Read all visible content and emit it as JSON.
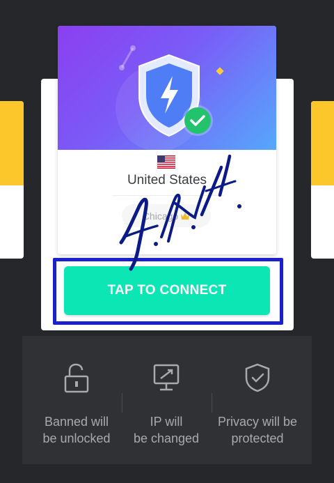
{
  "server": {
    "country": "United States",
    "city": "Chicago",
    "flag_icon": "us-flag-icon",
    "vip_icon": "crown-icon"
  },
  "connect": {
    "label": "TAP TO CONNECT"
  },
  "features": [
    {
      "icon": "unlock-icon",
      "line1": "Banned will",
      "line2": "be unlocked"
    },
    {
      "icon": "monitor-ip-icon",
      "line1": "IP will",
      "line2": "be changed"
    },
    {
      "icon": "shield-check-icon",
      "line1": "Privacy will be",
      "line2": "protected"
    }
  ],
  "colors": {
    "background": "#25272b",
    "accent": "#0ce6b5",
    "highlight": "#1a21c8",
    "side_card": "#fbc72b"
  }
}
